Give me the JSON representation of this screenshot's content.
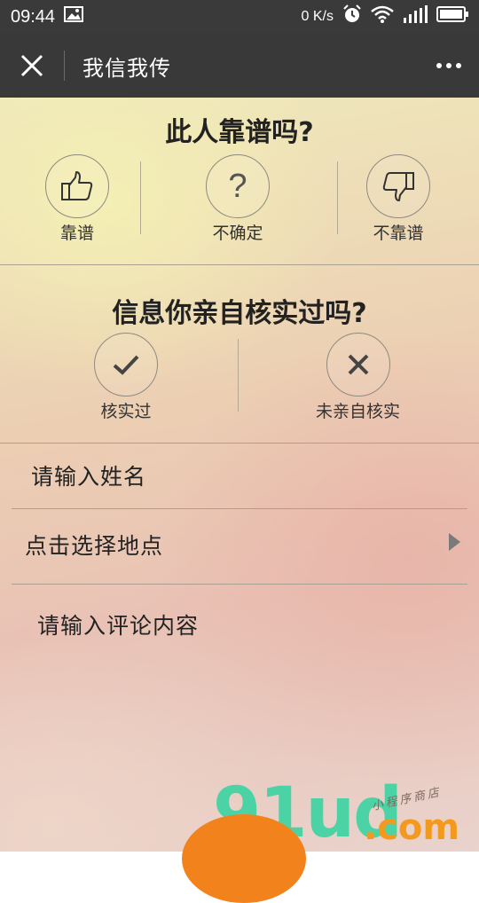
{
  "status_bar": {
    "time": "09:44",
    "net_speed": "0 K/s",
    "icons": [
      "image-icon",
      "alarm-icon",
      "wifi-icon",
      "signal-icon",
      "battery-icon"
    ]
  },
  "nav": {
    "title": "我信我传",
    "close_icon": "close-icon",
    "more_icon": "more-icon"
  },
  "reliability": {
    "question": "此人靠谱吗?",
    "options": [
      {
        "label": "靠谱",
        "icon": "thumbs-up-icon"
      },
      {
        "label": "不确定",
        "icon": "question-icon"
      },
      {
        "label": "不靠谱",
        "icon": "thumbs-down-icon"
      }
    ]
  },
  "verified": {
    "question": "信息你亲自核实过吗?",
    "options": [
      {
        "label": "核实过",
        "icon": "check-icon"
      },
      {
        "label": "未亲自核实",
        "icon": "cross-icon"
      }
    ]
  },
  "form": {
    "name_placeholder": "请输入姓名",
    "location_label": "点击选择地点",
    "comment_placeholder": "请输入评论内容"
  },
  "watermark": {
    "digits": "91ud",
    "domain": ".com",
    "tagline": "小程序商店"
  },
  "colors": {
    "nav_bg": "#393939",
    "watermark_green": "#4bd3a6",
    "watermark_orange": "#f39a1e"
  }
}
